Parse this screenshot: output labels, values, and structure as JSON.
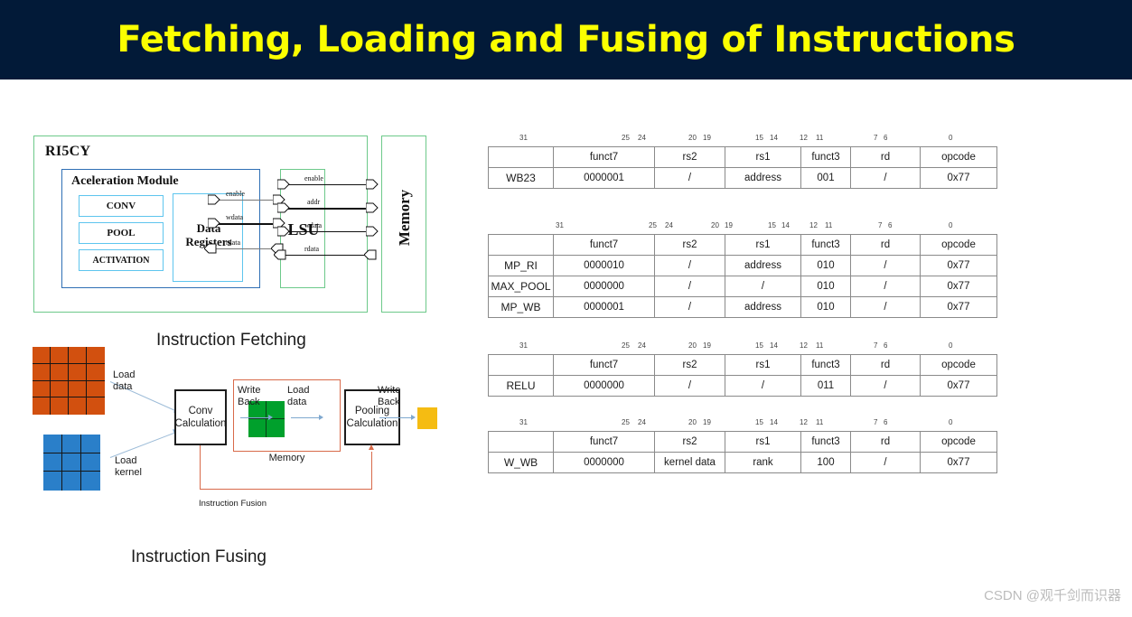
{
  "header": {
    "title": "Fetching, Loading and Fusing of Instructions",
    "bg_color": "#021a38",
    "title_color": "#fbff00"
  },
  "block_diagram": {
    "outer_label": "RI5CY",
    "accel_label": "Aceleration Module",
    "units": [
      "CONV",
      "POOL",
      "ACTIVATION"
    ],
    "data_registers": {
      "line1": "Data",
      "line2": "Registers"
    },
    "lsu_label": "LSU",
    "memory_label": "Memory",
    "signals_left": [
      "enable",
      "wdata",
      "rdata"
    ],
    "signals_right": [
      "enable",
      "addr",
      "wdata",
      "rdata"
    ],
    "colors": {
      "outer": "#6dc98a",
      "accel": "#2f6fb5",
      "unit": "#5ec5ee"
    }
  },
  "captions": {
    "fetching": "Instruction Fetching",
    "fusing": "Instruction Fusing"
  },
  "fusing_diagram": {
    "input_data_grid": {
      "rows": 4,
      "cols": 4,
      "color": "#d2500f"
    },
    "kernel_grid": {
      "rows": 3,
      "cols": 3,
      "color": "#2a7fc9"
    },
    "memory_grid": {
      "rows": 2,
      "cols": 2,
      "color": "#00a02c"
    },
    "output_square": {
      "color": "#f5bc12"
    },
    "conv_box": {
      "line1": "Conv",
      "line2": "Calculation"
    },
    "pooling_box": {
      "line1": "Pooling",
      "line2": "Calculation"
    },
    "memory_caption": "Memory",
    "labels": {
      "load_data": "Load\ndata",
      "load_kernel": "Load\nkernel",
      "write_back_1": "Write\nBack",
      "load_data_2": "Load\ndata",
      "write_back_2": "Write\nBack",
      "instruction_fusion": "Instruction Fusion"
    },
    "colors": {
      "fusion_line": "#d86a4a",
      "arrow": "#7fa8cf"
    }
  },
  "tables": {
    "bit_labels": [
      "31",
      "25",
      "24",
      "20",
      "19",
      "15",
      "14",
      "12",
      "11",
      "7",
      "6",
      "0"
    ],
    "headers": [
      "",
      "funct7",
      "rs2",
      "rs1",
      "funct3",
      "rd",
      "opcode"
    ],
    "groups": [
      {
        "id": "table-wb23",
        "rows": [
          {
            "name": "WB23",
            "funct7": "0000001",
            "rs2": "/",
            "rs1": "address",
            "funct3": "001",
            "rd": "/",
            "opcode": "0x77"
          }
        ]
      },
      {
        "id": "table-maxpool",
        "rows": [
          {
            "name": "MP_RI",
            "funct7": "0000010",
            "rs2": "/",
            "rs1": "address",
            "funct3": "010",
            "rd": "/",
            "opcode": "0x77"
          },
          {
            "name": "MAX_POOL",
            "funct7": "0000000",
            "rs2": "/",
            "rs1": "/",
            "funct3": "010",
            "rd": "/",
            "opcode": "0x77"
          },
          {
            "name": "MP_WB",
            "funct7": "0000001",
            "rs2": "/",
            "rs1": "address",
            "funct3": "010",
            "rd": "/",
            "opcode": "0x77"
          }
        ]
      },
      {
        "id": "table-relu",
        "rows": [
          {
            "name": "RELU",
            "funct7": "0000000",
            "rs2": "/",
            "rs1": "/",
            "funct3": "011",
            "rd": "/",
            "opcode": "0x77"
          }
        ]
      },
      {
        "id": "table-wwb",
        "rows": [
          {
            "name": "W_WB",
            "funct7": "0000000",
            "rs2": "kernel data",
            "rs1": "rank",
            "funct3": "100",
            "rd": "/",
            "opcode": "0x77"
          }
        ]
      }
    ]
  },
  "watermark": "CSDN @观千剑而识器"
}
